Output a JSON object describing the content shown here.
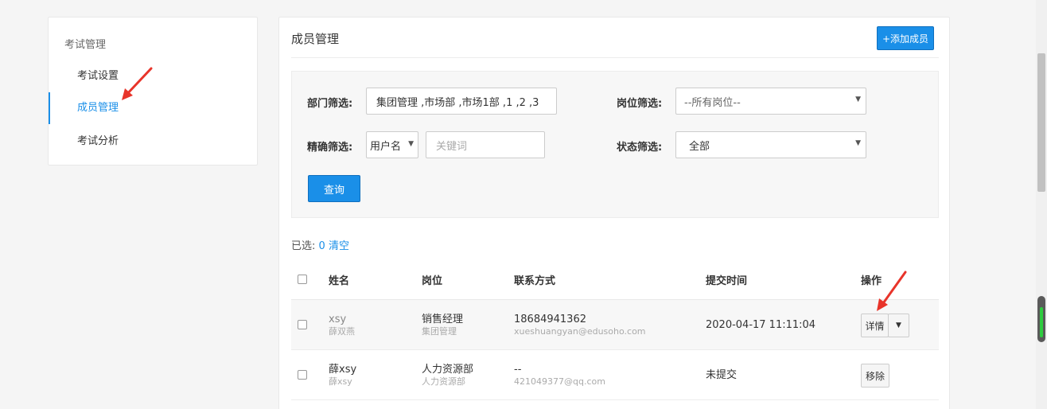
{
  "sidebar": {
    "heading": "考试管理",
    "items": [
      {
        "label": "考试设置"
      },
      {
        "label": "成员管理"
      },
      {
        "label": "考试分析"
      }
    ]
  },
  "main": {
    "title": "成员管理",
    "add_button": "+添加成员"
  },
  "filters": {
    "department_label": "部门筛选:",
    "department_value": "集团管理 ,市场部 ,市场1部 ,1 ,2 ,3",
    "position_label": "岗位筛选:",
    "position_value": "--所有岗位--",
    "exact_label": "精确筛选:",
    "exact_field_value": "用户名",
    "keyword_placeholder": "关键词",
    "status_label": "状态筛选:",
    "status_value": "全部",
    "query_button": "查询"
  },
  "selection": {
    "prefix": "已选:",
    "count": "0",
    "clear": "清空"
  },
  "table": {
    "headers": {
      "name": "姓名",
      "position": "岗位",
      "contact": "联系方式",
      "submit_time": "提交时间",
      "actions": "操作"
    },
    "rows": [
      {
        "name": "xsy",
        "name_sub": "薛双燕",
        "position": "销售经理",
        "position_sub": "集团管理",
        "contact": "18684941362",
        "contact_sub": "xueshuangyan@edusoho.com",
        "submit_time": "2020-04-17 11:11:04",
        "action": "详情"
      },
      {
        "name": "薛xsy",
        "name_sub": "薛xsy",
        "position": "人力资源部",
        "position_sub": "人力资源部",
        "contact": "--",
        "contact_sub": "421049377@qq.com",
        "submit_time": "未提交",
        "action": "移除"
      }
    ]
  },
  "icons": {
    "caret": "caret-down-icon",
    "checkbox": "checkbox-icon"
  },
  "colors": {
    "accent": "#1a8fe8",
    "annotation": "#e8342a"
  }
}
